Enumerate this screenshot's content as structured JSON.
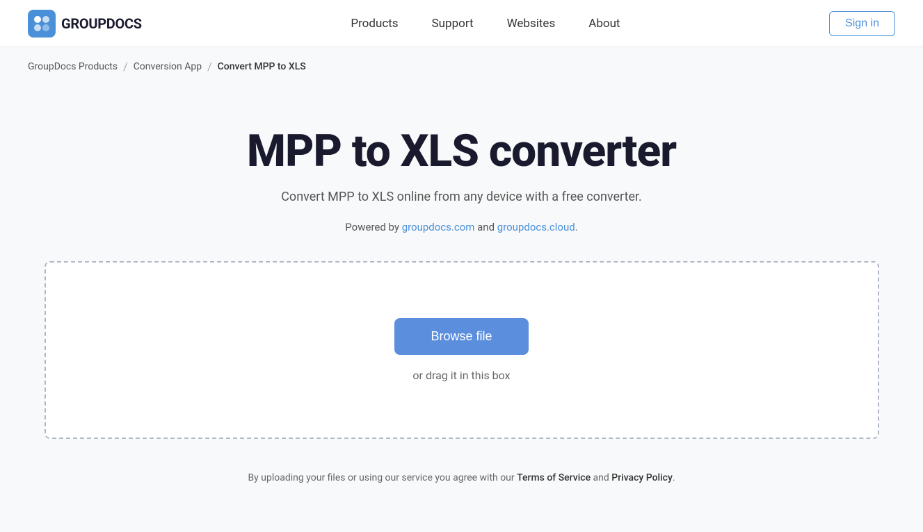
{
  "logo": {
    "text": "GROUPDOCS",
    "icon_name": "groupdocs-logo-icon"
  },
  "nav": {
    "links": [
      {
        "label": "Products",
        "id": "nav-products"
      },
      {
        "label": "Support",
        "id": "nav-support"
      },
      {
        "label": "Websites",
        "id": "nav-websites"
      },
      {
        "label": "About",
        "id": "nav-about"
      }
    ],
    "sign_in_label": "Sign in"
  },
  "breadcrumb": {
    "items": [
      {
        "label": "GroupDocs Products",
        "id": "bc-groupdocs"
      },
      {
        "label": "Conversion App",
        "id": "bc-conversion"
      },
      {
        "label": "Convert MPP to XLS",
        "id": "bc-current"
      }
    ]
  },
  "main": {
    "title": "MPP to XLS converter",
    "subtitle": "Convert MPP to XLS online from any device with a free converter.",
    "powered_by_prefix": "Powered by ",
    "powered_by_link1_text": "groupdocs.com",
    "powered_by_link1_url": "#",
    "powered_by_and": " and ",
    "powered_by_link2_text": "groupdocs.cloud",
    "powered_by_link2_url": "#",
    "powered_by_suffix": ".",
    "browse_file_label": "Browse file",
    "drag_text": "or drag it in this box"
  },
  "footer": {
    "prefix": "By uploading your files or using our service you agree with our ",
    "tos_label": "Terms of Service",
    "and_text": " and ",
    "privacy_label": "Privacy Policy",
    "suffix": "."
  }
}
